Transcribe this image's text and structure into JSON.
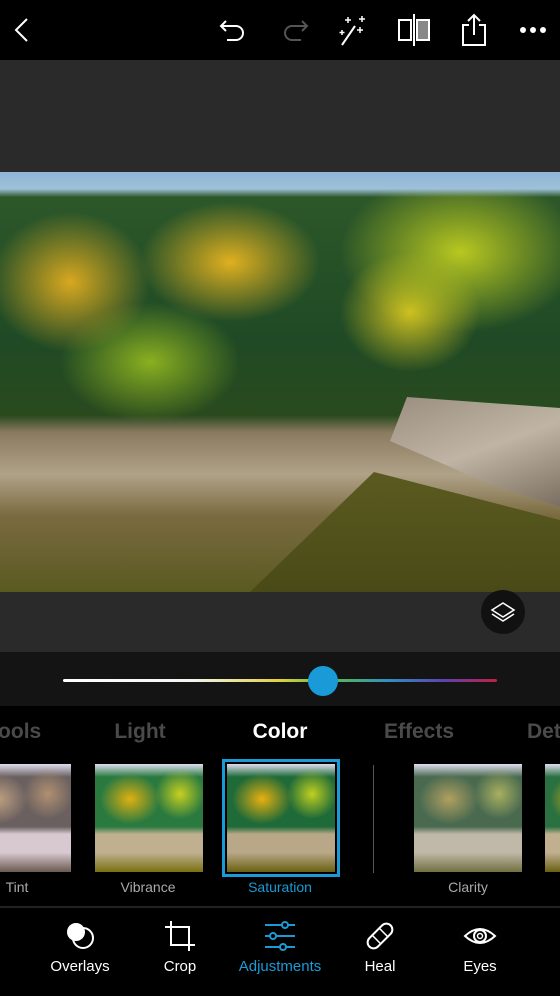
{
  "toolbar": {
    "icons": [
      "back-icon",
      "undo-icon",
      "redo-icon",
      "auto-fix-wand-icon",
      "compare-icon",
      "share-icon",
      "more-icon"
    ]
  },
  "slider": {
    "value_fraction": 0.6,
    "accent": "#1a9ad6"
  },
  "categories": [
    {
      "label": "Tools"
    },
    {
      "label": "Light"
    },
    {
      "label": "Color",
      "active": true
    },
    {
      "label": "Effects"
    },
    {
      "label": "Det"
    }
  ],
  "presets": [
    {
      "label": "Tint"
    },
    {
      "label": "Vibrance"
    },
    {
      "label": "Saturation",
      "selected": true
    },
    {
      "label": "Clarity"
    }
  ],
  "bottom_nav": [
    {
      "label": "Overlays"
    },
    {
      "label": "Crop"
    },
    {
      "label": "Adjustments",
      "active": true
    },
    {
      "label": "Heal"
    },
    {
      "label": "Eyes"
    }
  ],
  "colors": {
    "accent": "#1a9ad6",
    "background": "#000000",
    "canvas": "#2a2a2a"
  }
}
